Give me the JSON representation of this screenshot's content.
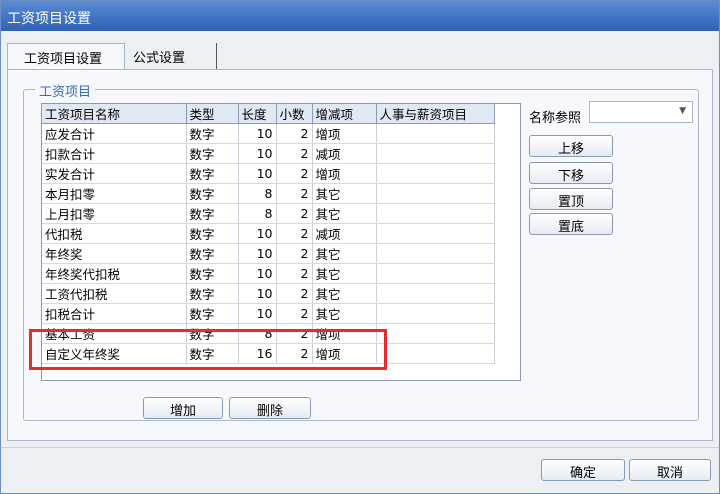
{
  "window": {
    "title": "工资项目设置"
  },
  "tabs": [
    {
      "label": "工资项目设置"
    },
    {
      "label": "公式设置"
    }
  ],
  "group": {
    "label": "工资项目"
  },
  "table": {
    "headers": [
      "工资项目名称",
      "类型",
      "长度",
      "小数",
      "增减项",
      "人事与薪资项目"
    ],
    "rows": [
      [
        "应发合计",
        "数字",
        "10",
        "2",
        "增项",
        ""
      ],
      [
        "扣款合计",
        "数字",
        "10",
        "2",
        "减项",
        ""
      ],
      [
        "实发合计",
        "数字",
        "10",
        "2",
        "增项",
        ""
      ],
      [
        "本月扣零",
        "数字",
        "8",
        "2",
        "其它",
        ""
      ],
      [
        "上月扣零",
        "数字",
        "8",
        "2",
        "其它",
        ""
      ],
      [
        "代扣税",
        "数字",
        "10",
        "2",
        "减项",
        ""
      ],
      [
        "年终奖",
        "数字",
        "10",
        "2",
        "其它",
        ""
      ],
      [
        "年终奖代扣税",
        "数字",
        "10",
        "2",
        "其它",
        ""
      ],
      [
        "工资代扣税",
        "数字",
        "10",
        "2",
        "其它",
        ""
      ],
      [
        "扣税合计",
        "数字",
        "10",
        "2",
        "其它",
        ""
      ],
      [
        "基本工资",
        "数字",
        "8",
        "2",
        "增项",
        ""
      ],
      [
        "自定义年终奖",
        "数字",
        "16",
        "2",
        "增项",
        ""
      ]
    ]
  },
  "name_ref": {
    "label": "名称参照",
    "value": ""
  },
  "side_buttons": {
    "up": "上移",
    "down": "下移",
    "top": "置顶",
    "bottom": "置底"
  },
  "row_buttons": {
    "add": "增加",
    "delete": "删除"
  },
  "footer": {
    "ok": "确定",
    "cancel": "取消"
  },
  "colors": {
    "title_bar": "#2f62b4",
    "highlight": "#e32d2d",
    "group_label": "#3a6bbf"
  }
}
